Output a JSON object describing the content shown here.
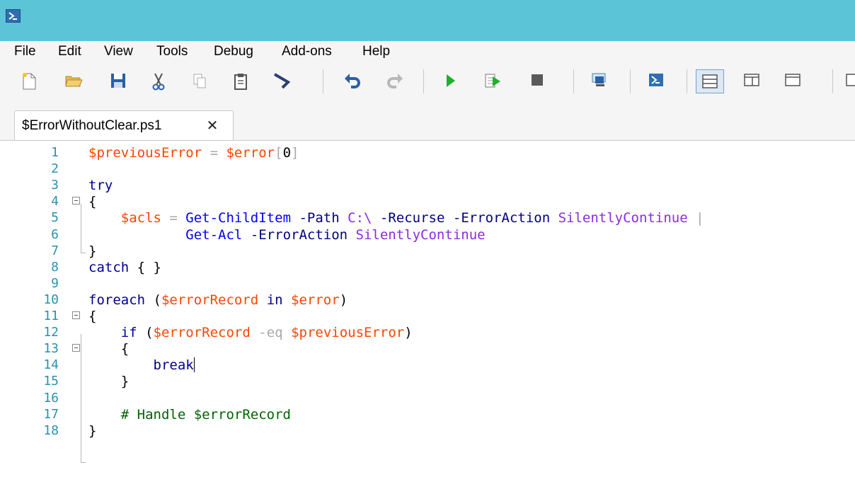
{
  "window": {
    "title": "",
    "accent": "#5bc4d6"
  },
  "menu": [
    "File",
    "Edit",
    "View",
    "Tools",
    "Debug",
    "Add-ons",
    "Help"
  ],
  "toolbar": {
    "buttons": [
      "new-icon",
      "open-icon",
      "save-icon",
      "cut-icon",
      "copy-icon",
      "paste-icon",
      "clear-console-icon",
      "undo-icon",
      "redo-icon",
      "run-icon",
      "run-selection-icon",
      "stop-icon",
      "remote-powershell-icon",
      "powershell-icon",
      "layout-top-icon",
      "layout-right-icon",
      "layout-maximized-icon"
    ]
  },
  "tab": {
    "label": "$ErrorWithoutClear.ps1",
    "close": "✕"
  },
  "editor": {
    "cursor_line": 14,
    "lines": [
      {
        "num": "1",
        "tokens": [
          [
            "var",
            "$previousError"
          ],
          [
            "op",
            " = "
          ],
          [
            "var",
            "$error"
          ],
          [
            "op",
            "["
          ],
          [
            "plain",
            "0"
          ],
          [
            "op",
            "]"
          ]
        ]
      },
      {
        "num": "2",
        "tokens": []
      },
      {
        "num": "3",
        "tokens": [
          [
            "kw",
            "try"
          ]
        ]
      },
      {
        "num": "4",
        "tokens": [
          [
            "plain",
            "{"
          ]
        ]
      },
      {
        "num": "5",
        "tokens": [
          [
            "plain",
            "    "
          ],
          [
            "var",
            "$acls"
          ],
          [
            "op",
            " = "
          ],
          [
            "cmd",
            "Get-ChildItem"
          ],
          [
            "plain",
            " "
          ],
          [
            "param",
            "-Path"
          ],
          [
            "plain",
            " "
          ],
          [
            "str",
            "C:\\"
          ],
          [
            "plain",
            " "
          ],
          [
            "param",
            "-Recurse"
          ],
          [
            "plain",
            " "
          ],
          [
            "param",
            "-ErrorAction"
          ],
          [
            "plain",
            " "
          ],
          [
            "str",
            "SilentlyContinue"
          ],
          [
            "plain",
            " "
          ],
          [
            "op",
            "|"
          ]
        ]
      },
      {
        "num": "6",
        "tokens": [
          [
            "plain",
            "            "
          ],
          [
            "cmd",
            "Get-Acl"
          ],
          [
            "plain",
            " "
          ],
          [
            "param",
            "-ErrorAction"
          ],
          [
            "plain",
            " "
          ],
          [
            "str",
            "SilentlyContinue"
          ]
        ]
      },
      {
        "num": "7",
        "tokens": [
          [
            "plain",
            "}"
          ]
        ]
      },
      {
        "num": "8",
        "tokens": [
          [
            "kw",
            "catch"
          ],
          [
            "plain",
            " { }"
          ]
        ]
      },
      {
        "num": "9",
        "tokens": []
      },
      {
        "num": "10",
        "tokens": [
          [
            "kw",
            "foreach"
          ],
          [
            "plain",
            " ("
          ],
          [
            "var",
            "$errorRecord"
          ],
          [
            "plain",
            " "
          ],
          [
            "kw",
            "in"
          ],
          [
            "plain",
            " "
          ],
          [
            "var",
            "$error"
          ],
          [
            "plain",
            ")"
          ]
        ]
      },
      {
        "num": "11",
        "tokens": [
          [
            "plain",
            "{"
          ]
        ]
      },
      {
        "num": "12",
        "tokens": [
          [
            "plain",
            "    "
          ],
          [
            "kw",
            "if"
          ],
          [
            "plain",
            " ("
          ],
          [
            "var",
            "$errorRecord"
          ],
          [
            "plain",
            " "
          ],
          [
            "op",
            "-eq"
          ],
          [
            "plain",
            " "
          ],
          [
            "var",
            "$previousError"
          ],
          [
            "plain",
            ")"
          ]
        ]
      },
      {
        "num": "13",
        "tokens": [
          [
            "plain",
            "    {"
          ]
        ]
      },
      {
        "num": "14",
        "tokens": [
          [
            "plain",
            "        "
          ],
          [
            "kw",
            "break"
          ]
        ]
      },
      {
        "num": "15",
        "tokens": [
          [
            "plain",
            "    }"
          ]
        ]
      },
      {
        "num": "16",
        "tokens": []
      },
      {
        "num": "17",
        "tokens": [
          [
            "plain",
            "    "
          ],
          [
            "com",
            "# Handle $errorRecord"
          ]
        ]
      },
      {
        "num": "18",
        "tokens": [
          [
            "plain",
            "}"
          ]
        ]
      }
    ]
  }
}
